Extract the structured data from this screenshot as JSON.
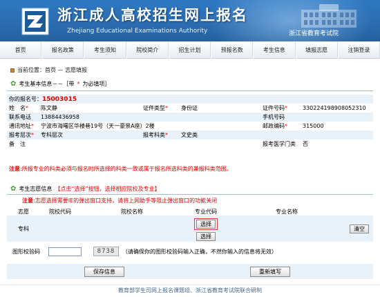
{
  "banner": {
    "title": "浙江成人高校招生网上报名",
    "subtitle": "Zhejiang Educational Examinations Authority",
    "org": "浙江省教育考试院",
    "logo_icon": "zk-logo-icon"
  },
  "nav": [
    "首页",
    "报名政策",
    "考生须知",
    "院校简介",
    "招生计划",
    "预报名数",
    "考生信息",
    "填报志愿",
    "注销登录"
  ],
  "breadcrumb": "当前位置：首页 — 志愿填报",
  "basic_info": {
    "title": "考生基本信息－－［带",
    "title_star": "*",
    "title_tail": "为必填项］",
    "regnum_label": "你的报名号：",
    "regnum": "15003015",
    "rows": {
      "name_label": "姓　名",
      "name": "陈文静",
      "idtype_label": "证件类型",
      "idtype": "身份证",
      "idnum_label": "证件号码",
      "idnum": "330224198908052310",
      "phone_label": "联系电话",
      "phone": "13884436958",
      "mobile_label": "手机号码",
      "mobile": "",
      "address_label": "通讯地址",
      "address": "宁波市海曙区华楼巷19号（天一豪景A座）2楼",
      "zip_label": "邮政编码",
      "zip": "315000",
      "level_label": "报考层次",
      "level": "专科层次",
      "subject_label": "报考科类",
      "subject": "文史类",
      "remark_label": "备　注",
      "remark": "",
      "medical_label": "报考医学门类",
      "medical": "否"
    },
    "note_tag": "注意",
    "note": ":所报专业的科类必须与报名时所选择的科类一致或属于报名所选科类的兼报科类范围。"
  },
  "choice": {
    "title": "考生志愿信息",
    "title_hint": "【点击“选择”按钮，选择相应院校及专业】",
    "note_tag": "注意",
    "note": ":志愿选择需要IE的弹出窗口支持，请将上网助手等阻止弹出窗口的功能关闭",
    "headers": [
      "志愿",
      "院校代码",
      "院校名称",
      "专业代码",
      "专业名称"
    ],
    "row_label": "专科",
    "select_btn": "选择",
    "clear_btn": "清空"
  },
  "captcha": {
    "label": "图形校验码",
    "input_value": "",
    "image_text": "8738",
    "tip": "（请确保你的图形校验码输入正确，不然你输入的信息将无效）"
  },
  "actions": {
    "save": "保存信息",
    "reset": "重新填写"
  },
  "footer": "教育部学生司网上报名课题组、浙江省教育考试院联合研制",
  "colors": {
    "banner": "#2b6db1",
    "required": "#e00000",
    "row_shade": "#e9f1f9",
    "footer_text": "#4a6a90"
  }
}
